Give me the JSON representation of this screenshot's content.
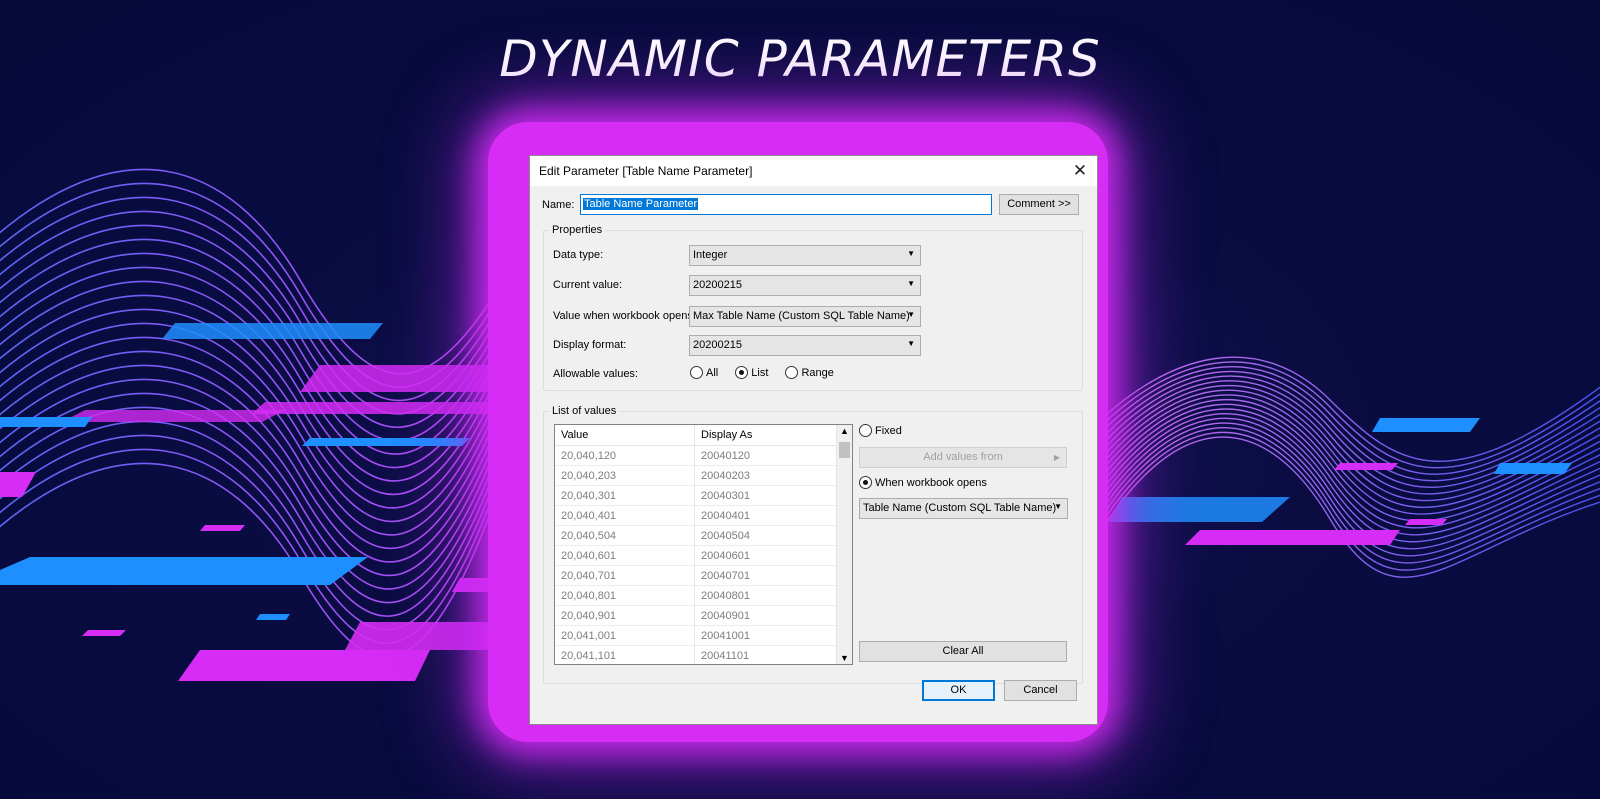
{
  "headline": "DYNAMIC PARAMETERS",
  "colors": {
    "background": "#060a3a",
    "glow": "#d62cf5",
    "accent_blue": "#1e8fff",
    "accent_pink": "#d62cf5",
    "selection": "#0078d7"
  },
  "dialog": {
    "title": "Edit Parameter [Table Name Parameter]",
    "close_icon": "close-icon",
    "name_label": "Name:",
    "name_value": "Table Name Parameter",
    "comment_button": "Comment >>",
    "properties": {
      "legend": "Properties",
      "data_type_label": "Data type:",
      "data_type_value": "Integer",
      "current_value_label": "Current value:",
      "current_value": "20200215",
      "workbook_opens_label": "Value when workbook opens:",
      "workbook_opens_value": "Max Table Name (Custom SQL Table Name)",
      "display_format_label": "Display format:",
      "display_format_value": "20200215",
      "allowable_label": "Allowable values:",
      "allowable_options": [
        "All",
        "List",
        "Range"
      ],
      "allowable_selected": "List"
    },
    "list_of_values": {
      "legend": "List of values",
      "col_value": "Value",
      "col_display": "Display As",
      "rows": [
        {
          "value": "20,040,120",
          "display": "20040120"
        },
        {
          "value": "20,040,203",
          "display": "20040203"
        },
        {
          "value": "20,040,301",
          "display": "20040301"
        },
        {
          "value": "20,040,401",
          "display": "20040401"
        },
        {
          "value": "20,040,504",
          "display": "20040504"
        },
        {
          "value": "20,040,601",
          "display": "20040601"
        },
        {
          "value": "20,040,701",
          "display": "20040701"
        },
        {
          "value": "20,040,801",
          "display": "20040801"
        },
        {
          "value": "20,040,901",
          "display": "20040901"
        },
        {
          "value": "20,041,001",
          "display": "20041001"
        },
        {
          "value": "20,041,101",
          "display": "20041101"
        }
      ],
      "fixed_label": "Fixed",
      "add_values_button": "Add values from",
      "when_opens_label": "When workbook opens",
      "source_value": "Table Name (Custom SQL Table Name)",
      "clear_button": "Clear All"
    },
    "ok_button": "OK",
    "cancel_button": "Cancel"
  }
}
